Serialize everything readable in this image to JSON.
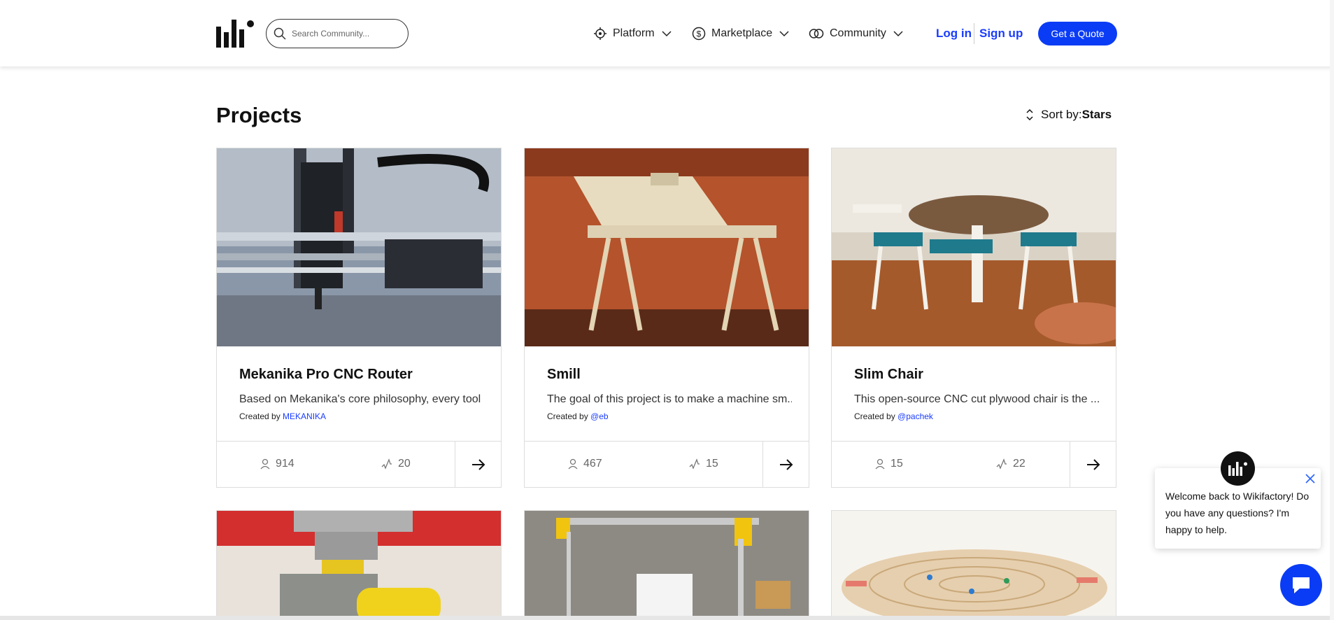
{
  "header": {
    "search_placeholder": "Search Community...",
    "nav": [
      {
        "label": "Platform"
      },
      {
        "label": "Marketplace"
      },
      {
        "label": "Community"
      }
    ],
    "login_label": "Log in",
    "signup_label": "Sign up",
    "quote_label": "Get a Quote",
    "accent_color": "#0a3cf5"
  },
  "page": {
    "title": "Projects",
    "sort_label": "Sort by:",
    "sort_value": "Stars"
  },
  "projects": [
    {
      "title": "Mekanika Pro CNC Router",
      "description": "Based on Mekanika's core philosophy, every tool ...",
      "created_by_label": "Created by",
      "creator": "MEKANIKA",
      "followers": "914",
      "stars": "20"
    },
    {
      "title": "Smill",
      "description": "The goal of this project is to make a machine sm...",
      "created_by_label": "Created by",
      "creator": "@eb",
      "followers": "467",
      "stars": "15"
    },
    {
      "title": "Slim Chair",
      "description": "This open-source CNC cut plywood chair is the ...",
      "created_by_label": "Created by",
      "creator": "@pachek",
      "followers": "15",
      "stars": "22"
    }
  ],
  "chat": {
    "message": "Welcome back to Wikifactory! Do you have any questions? I'm happy to help."
  },
  "icons": {
    "logo": "wikifactory-logo-icon",
    "search": "search-icon",
    "platform": "crosshair-icon",
    "marketplace": "marketplace-icon",
    "community": "community-icon",
    "chevron": "chevron-down-icon",
    "sort": "sort-icon",
    "followers": "user-icon",
    "stars": "activity-icon",
    "arrow": "arrow-right-icon",
    "close": "close-icon",
    "chat": "chat-icon"
  }
}
